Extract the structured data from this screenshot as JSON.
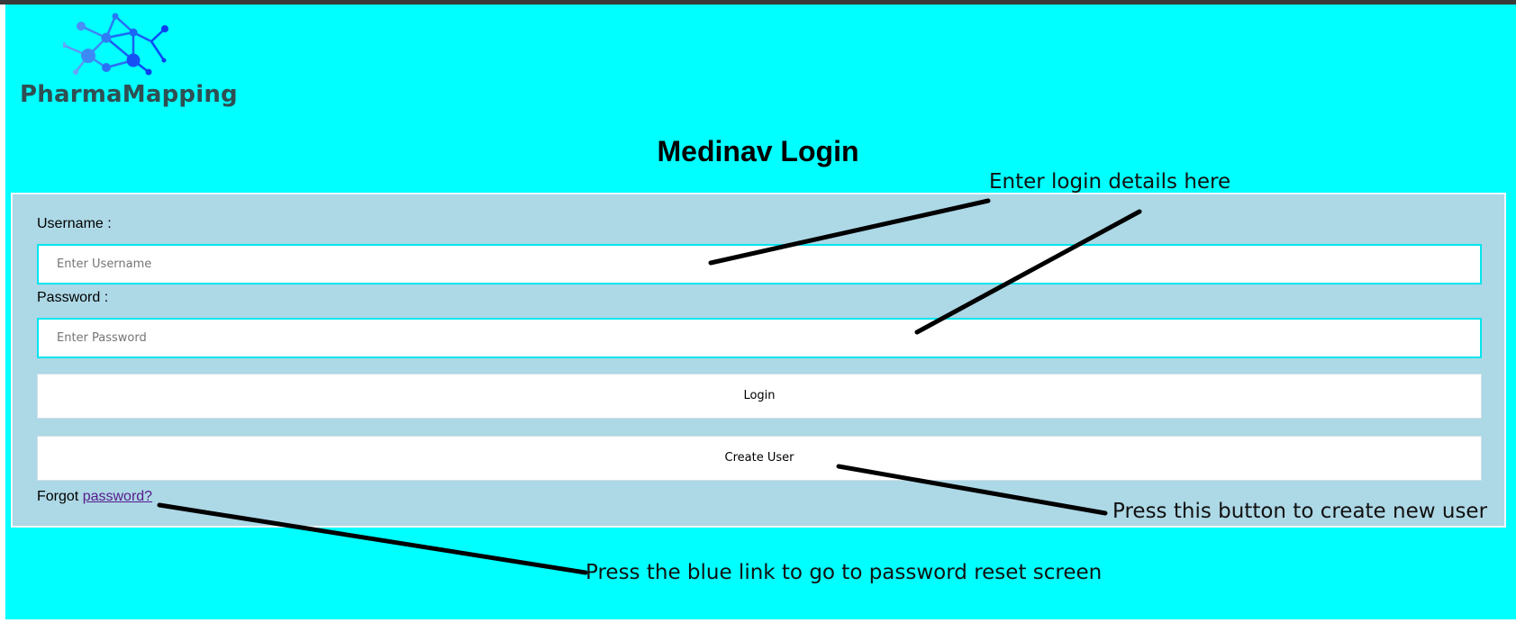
{
  "logo": {
    "text": "PharmaMapping",
    "icon": "molecule-network-icon"
  },
  "page_title": "Medinav Login",
  "form": {
    "username_label": "Username :",
    "username_placeholder": "Enter Username",
    "password_label": "Password :",
    "password_placeholder": "Enter Password",
    "login_label": "Login",
    "create_user_label": "Create User",
    "forgot_prefix": "Forgot",
    "forgot_link": "password?"
  },
  "annotations": {
    "login_details": "Enter login details here",
    "create_user": "Press this button to create new user",
    "password_reset": "Press the blue link to go to password reset screen"
  },
  "colors": {
    "page_background": "#00ffff",
    "form_background": "#add8e6",
    "input_border": "#00e5ee",
    "link": "#551a8b",
    "logo_text": "#2f4f52",
    "logo_icon": "#1e6cff"
  }
}
